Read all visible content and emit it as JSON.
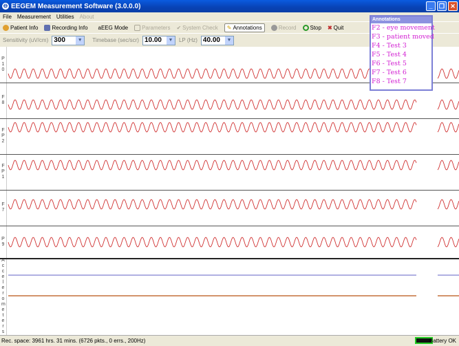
{
  "window": {
    "title": "EEGEM Measurement Software (3.0.0.0)"
  },
  "menu": [
    "File",
    "Measurement",
    "Utilities",
    "About"
  ],
  "toolbar": {
    "patient_info": "Patient Info",
    "recording_info": "Recording Info",
    "aeeg_mode": "aEEG Mode",
    "parameters": "Parameters",
    "system_check": "System Check",
    "annotations": "Annotations",
    "record": "Record",
    "stop": "Stop",
    "quit": "Quit"
  },
  "controls": {
    "sensitivity_label": "Sensitivity (uV/cm)",
    "sensitivity": "300",
    "timebase_label": "Timebase (sec/scr)",
    "timebase": "10.00",
    "lp_label": "LP (Hz)",
    "lp": "40.00"
  },
  "channels": [
    "P10",
    "F8",
    "FP2",
    "FP1",
    "F7",
    "P9",
    "Accelerometers"
  ],
  "colors": {
    "eeg": "#d03030",
    "accel_1": "#8080d0",
    "accel_2": "#b85010"
  },
  "annotations": {
    "title": "Annotations",
    "items": [
      "F2 - eye movement",
      "F3 - patient moved",
      "F4 - Test 3",
      "F5 - Test 4",
      "F6 - Test 5",
      "F7 - Test 6",
      "F8 - Test 7"
    ]
  },
  "status": {
    "text": "Rec. space: 3961 hrs. 31 mins. (6726 pkts., 0 errs., 200Hz)",
    "battery": "Battery OK"
  }
}
